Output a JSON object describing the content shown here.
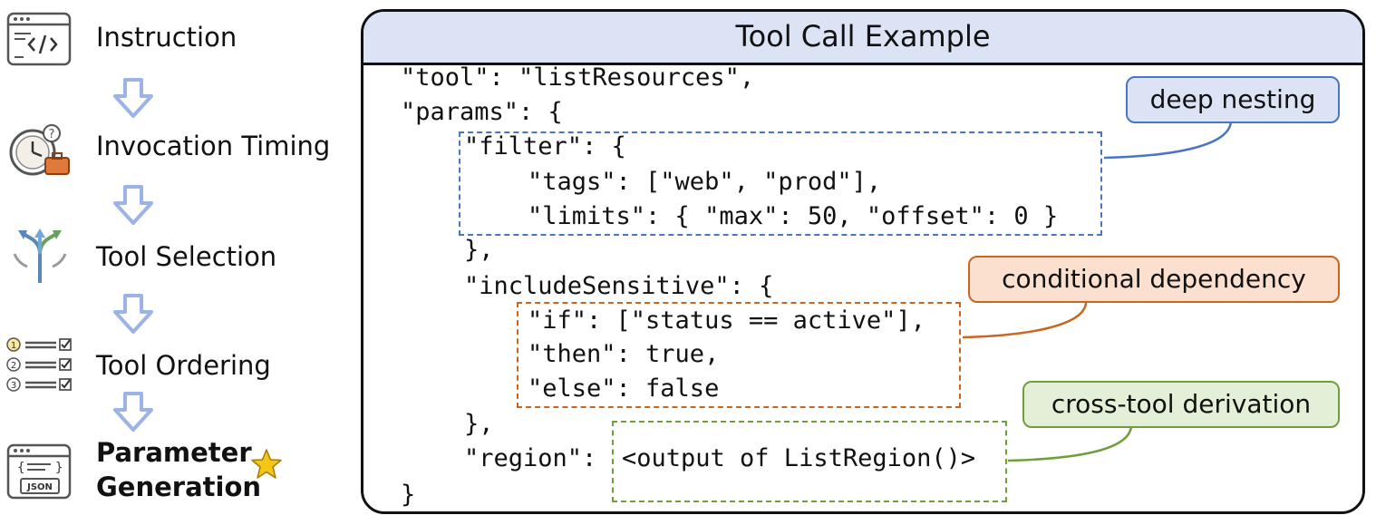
{
  "steps": [
    {
      "label": "Instruction",
      "icon": "code-window-icon"
    },
    {
      "label": "Invocation Timing",
      "icon": "clock-briefcase-icon"
    },
    {
      "label": "Tool Selection",
      "icon": "split-arrows-icon"
    },
    {
      "label": "Tool Ordering",
      "icon": "numbered-checklist-icon"
    },
    {
      "label_line1": "Parameter",
      "label_line2": "Generation",
      "icon": "json-window-icon",
      "badge": "star-icon"
    }
  ],
  "panel": {
    "title": "Tool Call Example",
    "code_lines": [
      "\"tool\": \"listResources\",",
      "\"params\": {",
      "\"filter\": {",
      "\"tags\": [\"web\", \"prod\"],",
      "\"limits\": { \"max\": 50, \"offset\": 0 }",
      "},",
      "\"includeSensitive\": {",
      "\"if\": [\"status == active\"],",
      "\"then\": true,",
      "\"else\": false",
      "},",
      "\"region\":",
      "<output of ListRegion()>",
      "}"
    ]
  },
  "annotations": [
    {
      "label": "deep nesting",
      "color": "#4a74c4",
      "fill": "#dbe3f5"
    },
    {
      "label": "conditional dependency",
      "color": "#c9651e",
      "fill": "#fbe0d0"
    },
    {
      "label": "cross-tool derivation",
      "color": "#6e9f3c",
      "fill": "#e3efd6"
    }
  ],
  "colors": {
    "arrow": "#9bb3e6",
    "panel_header": "#dbe3f5",
    "star": "#f5c518"
  }
}
